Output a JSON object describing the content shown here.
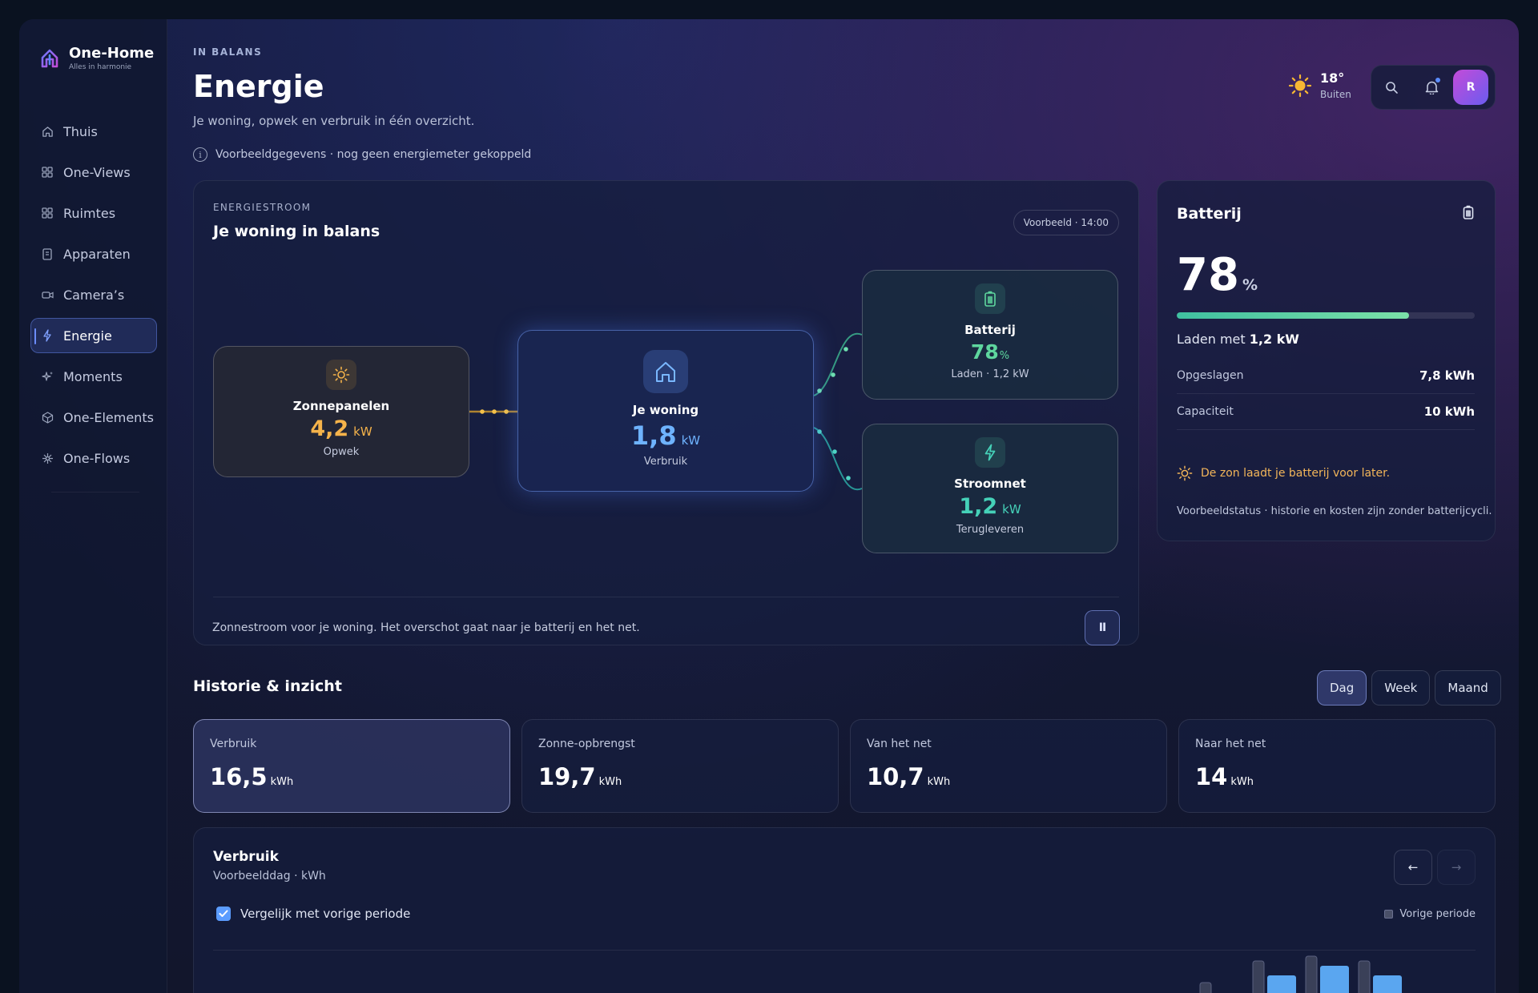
{
  "brand": {
    "name": "One-Home",
    "tagline": "Alles in harmonie"
  },
  "sidebar": {
    "items": [
      {
        "label": "Thuis",
        "icon": "home-icon"
      },
      {
        "label": "One-Views",
        "icon": "grid-icon"
      },
      {
        "label": "Ruimtes",
        "icon": "grid-icon"
      },
      {
        "label": "Apparaten",
        "icon": "device-icon"
      },
      {
        "label": "Camera’s",
        "icon": "camera-icon"
      },
      {
        "label": "Energie",
        "icon": "bolt-icon",
        "active": true
      },
      {
        "label": "Moments",
        "icon": "sparkle-icon"
      },
      {
        "label": "One-Elements",
        "icon": "cube-icon"
      },
      {
        "label": "One-Flows",
        "icon": "flow-icon"
      }
    ]
  },
  "header": {
    "status": "IN BALANS",
    "title": "Energie",
    "subtitle": "Je woning, opwek en verbruik in één overzicht.",
    "info": "Voorbeeldgegevens · nog geen energiemeter gekoppeld",
    "weather": {
      "temp": "18°",
      "label": "Buiten",
      "icon": "sun-icon"
    },
    "avatar_initial": "R"
  },
  "flow": {
    "kicker": "ENERGIESTROOM",
    "title": "Je woning in balans",
    "chip": "Voorbeeld · 14:00",
    "solar": {
      "name": "Zonnepanelen",
      "value": "4,2",
      "unit": "kW",
      "detail": "Opwek"
    },
    "home": {
      "name": "Je woning",
      "value": "1,8",
      "unit": "kW",
      "detail": "Verbruik"
    },
    "battery": {
      "name": "Batterij",
      "value": "78",
      "unit": "%",
      "detail": "Laden · 1,2 kW"
    },
    "grid": {
      "name": "Stroomnet",
      "value": "1,2",
      "unit": "kW",
      "detail": "Terugleveren"
    },
    "description": "Zonnestroom voor je woning. Het overschot gaat naar je batterij en het net.",
    "pause_label": "II"
  },
  "battery_card": {
    "title": "Batterij",
    "percent": "78",
    "percent_unit": "%",
    "level": 0.78,
    "status_prefix": "Laden met",
    "status_value": "1,2 kW",
    "rows": [
      {
        "label": "Opgeslagen",
        "value": "7,8 kWh"
      },
      {
        "label": "Capaciteit",
        "value": "10 kWh"
      }
    ],
    "sun_message": "De zon laadt je batterij voor later.",
    "note": "Voorbeeldstatus · historie en kosten zijn zonder batterijcycli."
  },
  "history": {
    "title": "Historie & inzicht",
    "periods": [
      "Dag",
      "Week",
      "Maand"
    ],
    "active_period": "Dag",
    "stats": [
      {
        "label": "Verbruik",
        "value": "16,5",
        "unit": "kWh"
      },
      {
        "label": "Zonne-opbrengst",
        "value": "19,7",
        "unit": "kWh"
      },
      {
        "label": "Van het net",
        "value": "10,7",
        "unit": "kWh"
      },
      {
        "label": "Naar het net",
        "value": "14",
        "unit": "kWh"
      }
    ]
  },
  "usage_chart": {
    "title": "Verbruik",
    "subtitle": "Voorbeelddag · kWh",
    "compare_label": "Vergelijk met vorige periode",
    "compare_checked": true,
    "legend_previous": "Vorige periode",
    "prev_button": "←",
    "next_button": "→",
    "colors": {
      "current": "#5aa6f0",
      "previous": "#3a4058"
    }
  },
  "chart_data": {
    "type": "bar",
    "title": "Verbruik",
    "series": [
      {
        "name": "Vorige periode",
        "values": [
          0.45,
          0.9,
          1.0,
          0.9
        ]
      },
      {
        "values": [
          0.1,
          0.6,
          0.8,
          0.6
        ]
      }
    ],
    "ylim": [
      0,
      1.0
    ]
  }
}
